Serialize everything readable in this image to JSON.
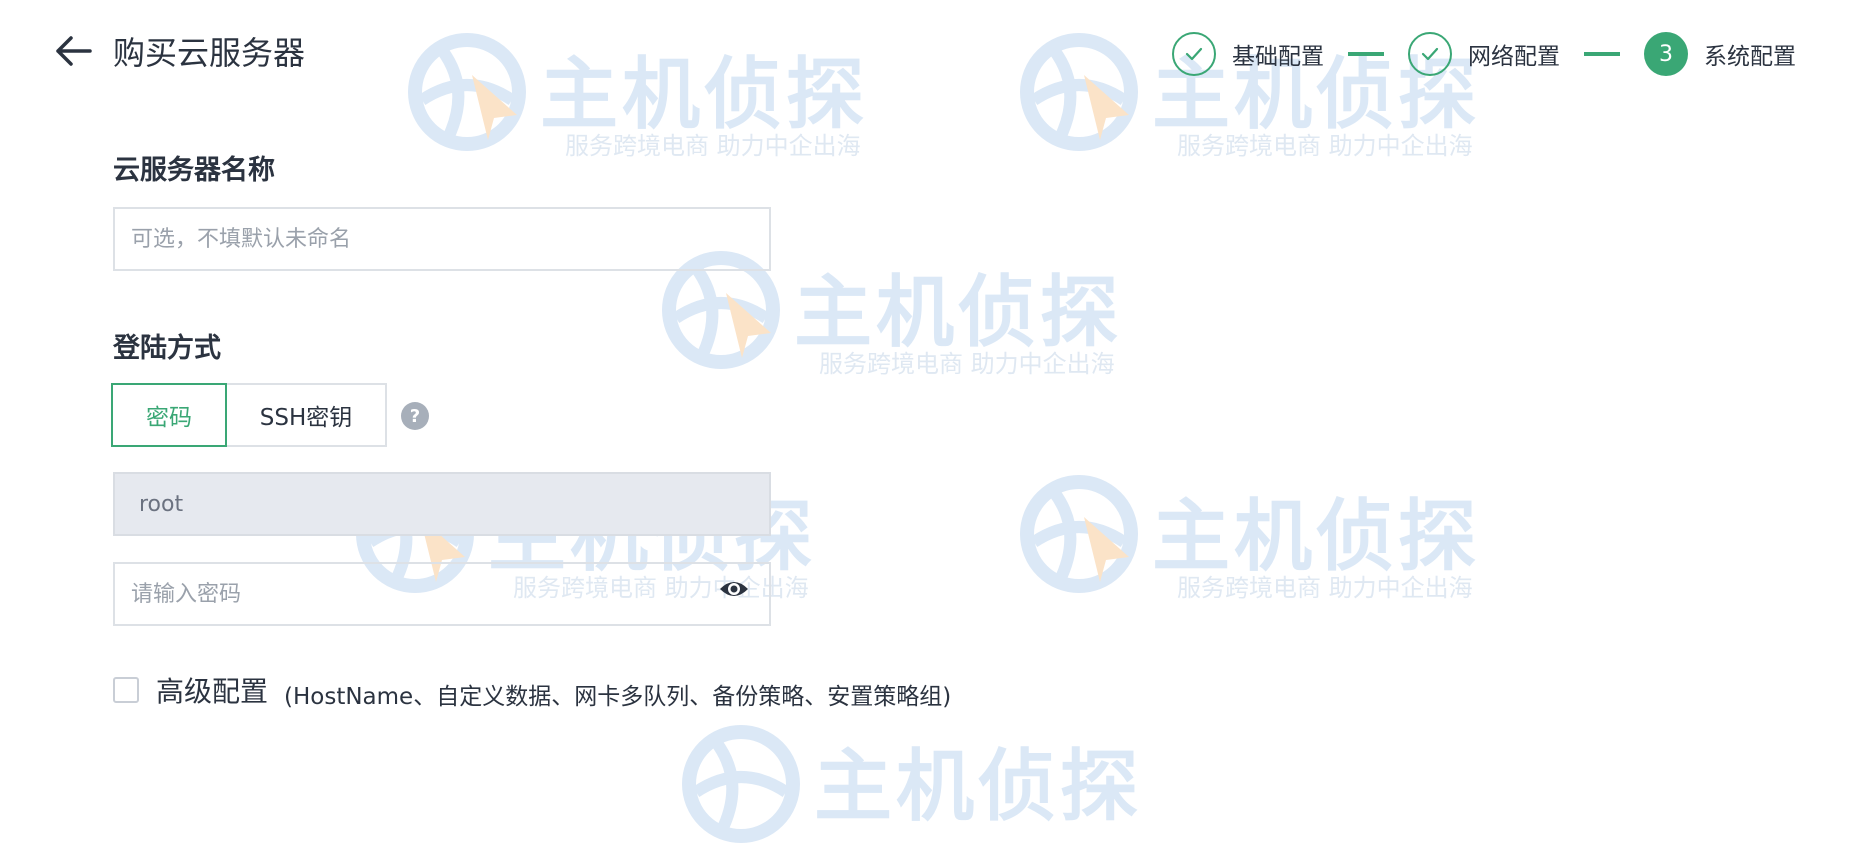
{
  "header": {
    "title": "购买云服务器",
    "back_icon": "arrow-left-icon"
  },
  "steps": [
    {
      "label": "基础配置",
      "state": "completed",
      "icon": "check-icon"
    },
    {
      "label": "网络配置",
      "state": "completed",
      "icon": "check-icon"
    },
    {
      "label": "系统配置",
      "state": "active",
      "number": "3"
    }
  ],
  "form": {
    "server_name": {
      "label": "云服务器名称",
      "placeholder": "可选，不填默认未命名",
      "value": ""
    },
    "login": {
      "label": "登陆方式",
      "options": [
        "密码",
        "SSH密钥"
      ],
      "selected": "密码",
      "help_icon": "question-mark-icon",
      "username": "root",
      "password_placeholder": "请输入密码",
      "visibility_icon": "eye-icon"
    },
    "advanced": {
      "checked": false,
      "label": "高级配置",
      "description": "(HostName、自定义数据、网卡多队列、备份策略、安置策略组)"
    }
  },
  "watermark": {
    "title": "主机侦探",
    "subtitle": "服务跨境电商 助力中企出海"
  },
  "colors": {
    "accent": "#3aa775",
    "text": "#2b3340",
    "readonly_bg": "#e6e9ef",
    "watermark": "#dbe8f6"
  }
}
